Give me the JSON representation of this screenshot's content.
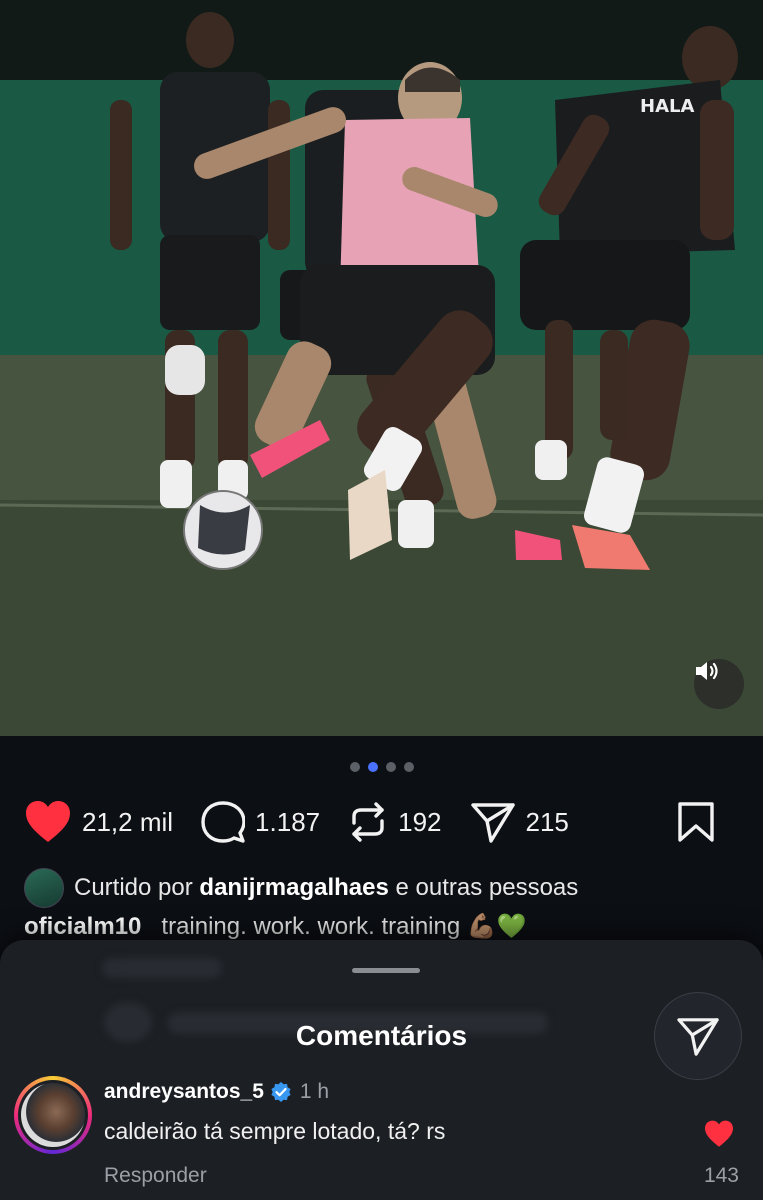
{
  "post": {
    "carousel_pages": 4,
    "carousel_active_index": 1,
    "likes": "21,2 mil",
    "comments": "1.187",
    "reposts": "192",
    "shares": "215",
    "liked_by_prefix": "Curtido por",
    "liked_by_user": "danijrmagalhaes",
    "liked_by_suffix": "e outras pessoas",
    "author": "oficialm10",
    "caption": "training. work. work. training 💪🏽💚",
    "jersey_text": "HALA"
  },
  "comments_sheet": {
    "title": "Comentários",
    "comment": {
      "username": "andreysantos_5",
      "verified": true,
      "time": "1 h",
      "text": "caldeirão tá sempre lotado, tá? rs",
      "reply_label": "Responder",
      "like_count": "143",
      "liked": true
    }
  },
  "colors": {
    "like_red": "#ff3040",
    "accent_blue": "#4a72ff",
    "verified_blue": "#3897f0"
  }
}
